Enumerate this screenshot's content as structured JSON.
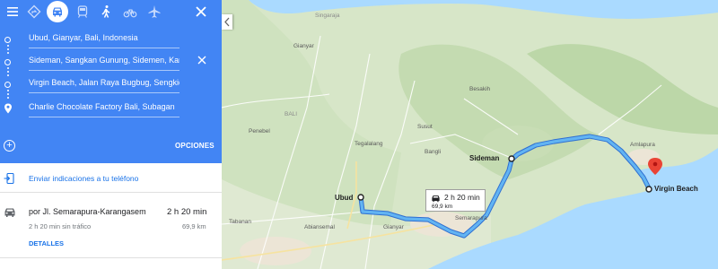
{
  "travel_modes": [
    {
      "name": "recommended",
      "icon": "diamond-arrow-icon",
      "active": false
    },
    {
      "name": "car",
      "icon": "car-icon",
      "active": true
    },
    {
      "name": "transit",
      "icon": "train-icon",
      "active": false
    },
    {
      "name": "walking",
      "icon": "walking-icon",
      "active": false
    },
    {
      "name": "cycling",
      "icon": "bicycle-icon",
      "active": false
    },
    {
      "name": "flight",
      "icon": "plane-icon",
      "active": false
    }
  ],
  "stops": [
    "Ubud, Gianyar, Bali, Indonesia",
    "Sideman, Sangkan Gunung, Sidemen, Karangasem",
    "Virgin Beach, Jalan Raya Bugbug, Sengkidu",
    "Charlie Chocolate Factory Bali, Subagan"
  ],
  "options_label": "OPCIONES",
  "send_to_phone": "Enviar indicaciones a tu teléfono",
  "route": {
    "via": "por Jl. Semarapura-Karangasem",
    "duration": "2 h 20 min",
    "subtitle": "2 h 20 min sin tráfico",
    "distance": "69,9 km",
    "details_label": "DETALLES"
  },
  "callout": {
    "duration": "2 h 20 min",
    "distance": "69,9 km"
  },
  "map_labels": {
    "ubud": "Ubud",
    "sideman": "Sideman",
    "virgin_beach": "Virgin Beach",
    "gianyar_town": "Gianyar",
    "gianyar_north": "Gianyar",
    "singaraja": "Singaraja",
    "besakih": "Besakih",
    "susut": "Susut",
    "bangli": "Bangli",
    "amlapura": "Amlapura",
    "tegalalang": "Tegalalang",
    "tabanan": "Tabanan",
    "abiansemal": "Abiansemal",
    "penebel": "Penebel",
    "bali": "BALI",
    "semarapura": "Semarapura"
  },
  "colors": {
    "accent": "#4285f4",
    "route": "#4a9be8",
    "pin": "#ea4335",
    "link": "#1a73e8"
  }
}
